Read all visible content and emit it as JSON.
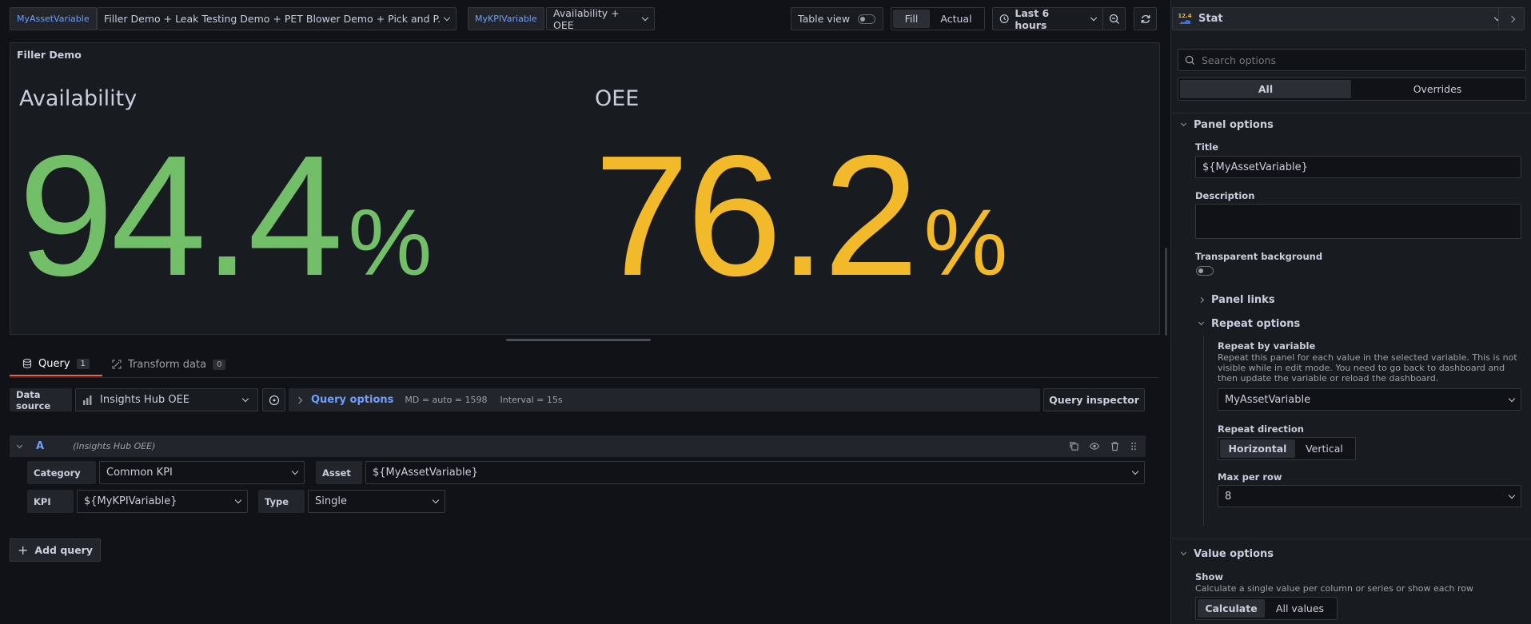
{
  "toolbar": {
    "asset_var_label": "MyAssetVariable",
    "asset_var_value": "Filler Demo + Leak Testing Demo + PET Blower Demo + Pick and P...",
    "kpi_var_label": "MyKPIVariable",
    "kpi_var_value": "Availability + OEE",
    "table_view_label": "Table view",
    "fill_label": "Fill",
    "actual_label": "Actual",
    "time_range": "Last 6 hours"
  },
  "viz_picker": {
    "icon_text": "12.4",
    "label": "Stat"
  },
  "panel": {
    "title": "Filler Demo",
    "stats": [
      {
        "label": "Availability",
        "value": "94.4",
        "unit": "%",
        "color": "#73bf69"
      },
      {
        "label": "OEE",
        "value": "76.2",
        "unit": "%",
        "color": "#f2b92b"
      }
    ]
  },
  "query_tabs": {
    "query_label": "Query",
    "query_count": "1",
    "transform_label": "Transform data",
    "transform_count": "0"
  },
  "query_bar": {
    "datasource_label": "Data source",
    "datasource_value": "Insights Hub OEE",
    "query_options_label": "Query options",
    "md_info": "MD = auto = 1598",
    "interval_info": "Interval = 15s",
    "inspector_label": "Query inspector"
  },
  "query_row": {
    "ref_id": "A",
    "ds_name": "(Insights Hub OEE)",
    "category_label": "Category",
    "category_value": "Common KPI",
    "asset_label": "Asset",
    "asset_value": "${MyAssetVariable}",
    "kpi_label": "KPI",
    "kpi_value": "${MyKPIVariable}",
    "type_label": "Type",
    "type_value": "Single",
    "add_query_label": "Add query"
  },
  "options": {
    "search_placeholder": "Search options",
    "tab_all": "All",
    "tab_overrides": "Overrides",
    "panel_options_title": "Panel options",
    "title_label": "Title",
    "title_value": "${MyAssetVariable}",
    "description_label": "Description",
    "transparent_label": "Transparent background",
    "panel_links_title": "Panel links",
    "repeat_options_title": "Repeat options",
    "repeat_by_label": "Repeat by variable",
    "repeat_by_desc": "Repeat this panel for each value in the selected variable. This is not visible while in edit mode. You need to go back to dashboard and then update the variable or reload the dashboard.",
    "repeat_by_value": "MyAssetVariable",
    "repeat_dir_label": "Repeat direction",
    "dir_horizontal": "Horizontal",
    "dir_vertical": "Vertical",
    "max_per_row_label": "Max per row",
    "max_per_row_value": "8",
    "value_options_title": "Value options",
    "show_label": "Show",
    "show_desc": "Calculate a single value per column or series or show each row",
    "show_calculate": "Calculate",
    "show_all_values": "All values"
  }
}
